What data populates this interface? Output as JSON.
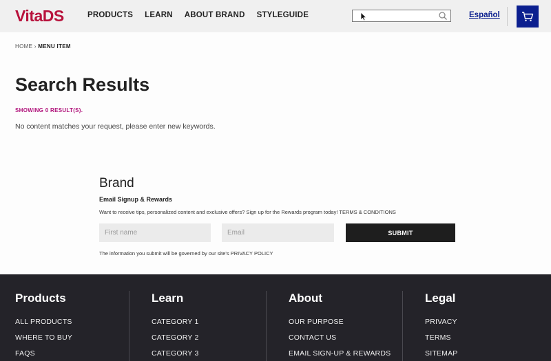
{
  "header": {
    "logo": "VitaDS",
    "nav": [
      "PRODUCTS",
      "LEARN",
      "ABOUT BRAND",
      "STYLEGUIDE"
    ],
    "search_value": "",
    "language_link": "Español"
  },
  "breadcrumb": {
    "home": "HOME",
    "separator": "›",
    "current": "MENU ITEM"
  },
  "main": {
    "title": "Search Results",
    "results_count": "SHOWING 0 RESULT(S).",
    "message": "No content matches your request, please enter new keywords."
  },
  "signup": {
    "brand": "Brand",
    "title": "Email Signup & Rewards",
    "description": "Want to receive tips, personalized content and exclusive offers? Sign up for the Rewards program today! TERMS & CONDITIONS",
    "first_name_placeholder": "First name",
    "email_placeholder": "Email",
    "submit_label": "SUBMIT",
    "privacy_note": "The information you submit will be governed by our site's PRIVACY POLICY"
  },
  "footer": {
    "columns": [
      {
        "heading": "Products",
        "links": [
          "ALL PRODUCTS",
          "WHERE TO BUY",
          "FAQS"
        ]
      },
      {
        "heading": "Learn",
        "links": [
          "CATEGORY 1",
          "CATEGORY 2",
          "CATEGORY 3"
        ]
      },
      {
        "heading": "About",
        "links": [
          "OUR PURPOSE",
          "CONTACT US",
          "EMAIL SIGN-UP & REWARDS"
        ]
      },
      {
        "heading": "Legal",
        "links": [
          "PRIVACY",
          "TERMS",
          "SITEMAP"
        ]
      }
    ]
  },
  "colors": {
    "brand_red": "#b8123c",
    "accent_blue": "#0b1f8f",
    "results_magenta": "#b0127a",
    "footer_bg": "#242329"
  },
  "icons": [
    "search-icon",
    "cart-icon",
    "mouse-cursor-icon"
  ]
}
